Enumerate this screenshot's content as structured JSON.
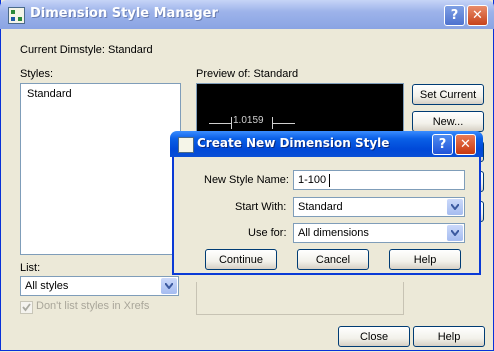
{
  "window": {
    "title": "Dimension Style Manager",
    "help_glyph": "?",
    "close_glyph": "✕"
  },
  "current_dimstyle": "Current Dimstyle: Standard",
  "styles": {
    "label": "Styles:",
    "items": [
      "Standard"
    ]
  },
  "preview": {
    "label": "Preview of: Standard",
    "dimension_text": "1.0159"
  },
  "list": {
    "label": "List:",
    "selected": "All styles"
  },
  "dont_list_xrefs": {
    "label": "Don't list styles in Xrefs",
    "checked": true
  },
  "side_buttons": {
    "set_current": "Set Current",
    "new": "New..."
  },
  "bottom_buttons": {
    "close": "Close",
    "help": "Help"
  },
  "dialog": {
    "title": "Create New Dimension Style",
    "help_glyph": "?",
    "close_glyph": "✕",
    "new_style_name_label": "New Style Name:",
    "new_style_name_value": "1-100",
    "start_with_label": "Start With:",
    "start_with_value": "Standard",
    "use_for_label": "Use for:",
    "use_for_value": "All dimensions",
    "continue_label": "Continue",
    "cancel_label": "Cancel",
    "help_label": "Help"
  }
}
